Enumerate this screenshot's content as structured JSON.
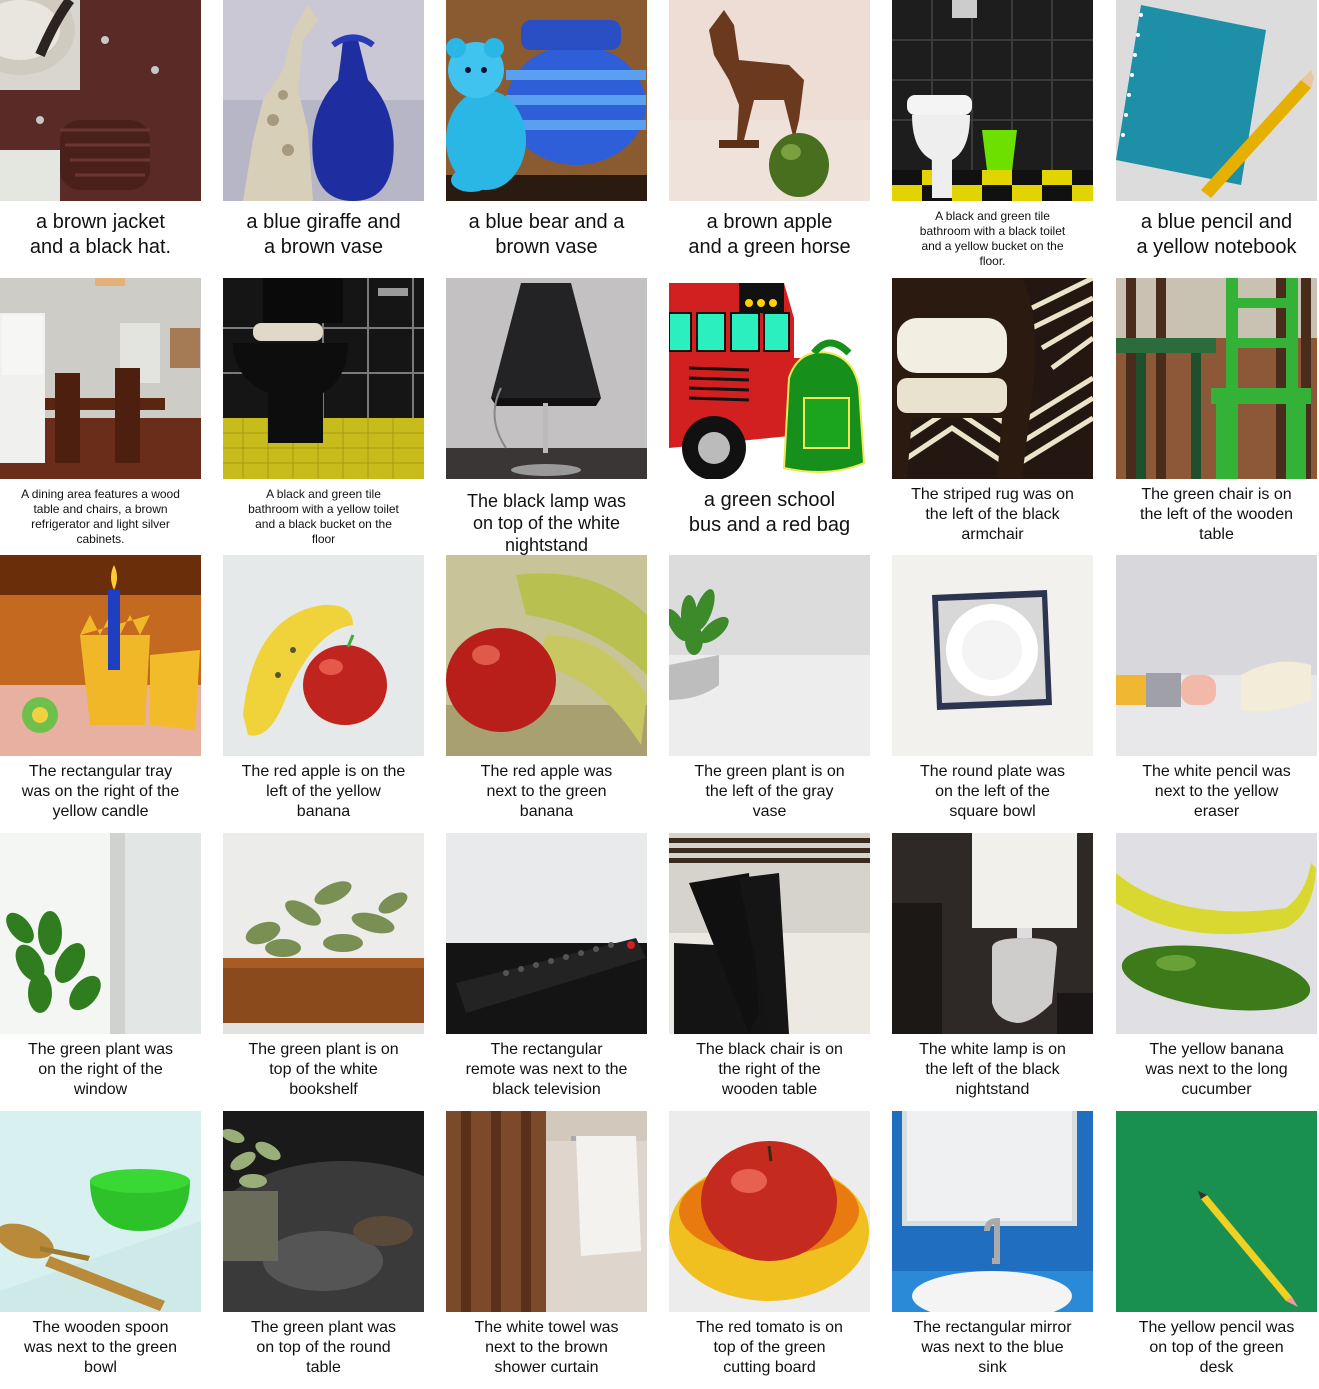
{
  "rows": [
    [
      {
        "caption": "a brown jacket\nand a black hat.",
        "size": "big"
      },
      {
        "caption": "a blue giraffe and\na brown vase",
        "size": "big"
      },
      {
        "caption": "a blue bear and a\nbrown vase",
        "size": "big"
      },
      {
        "caption": "a brown apple\nand a green horse",
        "size": "big"
      },
      {
        "caption": "A black and green tile\nbathroom with a black toilet\nand a yellow bucket on the\nfloor.",
        "size": "small"
      },
      {
        "caption": "a blue pencil and\na yellow notebook",
        "size": "big"
      }
    ],
    [
      {
        "caption": "A dining area features a wood\ntable and chairs, a brown\nrefrigerator and light silver\ncabinets.",
        "size": "small"
      },
      {
        "caption": "A black and green tile\nbathroom with a yellow toilet\nand a black bucket on the\nfloor",
        "size": "small"
      },
      {
        "caption": "The black lamp was\non top of the white\nnightstand",
        "size": "med-large"
      },
      {
        "caption": "a green school\nbus and a red bag",
        "size": "big"
      },
      {
        "caption": "The striped rug was on\nthe left of the black\narmchair",
        "size": "med"
      },
      {
        "caption": "The green chair is on\nthe left of the wooden\ntable",
        "size": "med"
      }
    ],
    [
      {
        "caption": "The rectangular tray\nwas on the right of the\nyellow candle",
        "size": "med"
      },
      {
        "caption": "The red apple is on the\nleft of the yellow\nbanana",
        "size": "med"
      },
      {
        "caption": "The red apple was\nnext to the green\nbanana",
        "size": "med"
      },
      {
        "caption": "The green plant is on\nthe left of the gray\nvase",
        "size": "med"
      },
      {
        "caption": "The round plate was\non the left of the\nsquare bowl",
        "size": "med"
      },
      {
        "caption": "The white pencil was\nnext to the yellow\neraser",
        "size": "med"
      }
    ],
    [
      {
        "caption": "The green plant was\non the right of the\nwindow",
        "size": "med"
      },
      {
        "caption": "The green plant is on\ntop of the white\nbookshelf",
        "size": "med"
      },
      {
        "caption": "The rectangular\nremote was next to the\nblack television",
        "size": "med"
      },
      {
        "caption": "The black chair is on\nthe right of the\nwooden table",
        "size": "med"
      },
      {
        "caption": "The white lamp is on\nthe left of the black\nnightstand",
        "size": "med"
      },
      {
        "caption": "The yellow banana\nwas next to the long\ncucumber",
        "size": "med"
      }
    ],
    [
      {
        "caption": "The wooden spoon\nwas next to the green\nbowl",
        "size": "med"
      },
      {
        "caption": "The green plant was\non top of the round\ntable",
        "size": "med"
      },
      {
        "caption": "The white towel was\nnext to the brown\nshower curtain",
        "size": "med"
      },
      {
        "caption": "The red tomato is on\ntop of the green\ncutting board",
        "size": "med"
      },
      {
        "caption": "The rectangular mirror\nwas next to the blue\nsink",
        "size": "med"
      },
      {
        "caption": "The yellow pencil was\non top of the green\ndesk",
        "size": "med"
      }
    ]
  ]
}
